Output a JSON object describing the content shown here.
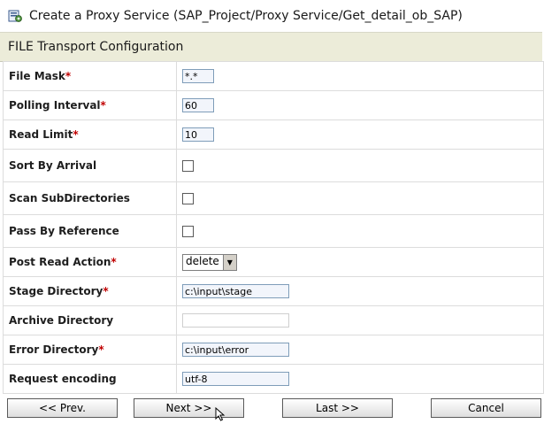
{
  "title": {
    "text": "Create a Proxy Service (SAP_Project/Proxy Service/Get_detail_ob_SAP)",
    "icon": "proxy-service-icon"
  },
  "section": {
    "title": "FILE Transport Configuration"
  },
  "form": {
    "file_mask": {
      "label": "File Mask",
      "required": "*",
      "value": "*.*"
    },
    "polling_interval": {
      "label": "Polling Interval",
      "required": "*",
      "value": "60"
    },
    "read_limit": {
      "label": "Read Limit",
      "required": "*",
      "value": "10"
    },
    "sort_by_arrival": {
      "label": "Sort By Arrival",
      "checked": false
    },
    "scan_subdirectories": {
      "label": "Scan SubDirectories",
      "checked": false
    },
    "pass_by_reference": {
      "label": "Pass By Reference",
      "checked": false
    },
    "post_read_action": {
      "label": "Post Read Action",
      "required": "*",
      "value": "delete"
    },
    "stage_directory": {
      "label": "Stage Directory",
      "required": "*",
      "value": "c:\\input\\stage"
    },
    "archive_directory": {
      "label": "Archive Directory",
      "value": ""
    },
    "error_directory": {
      "label": "Error Directory",
      "required": "*",
      "value": "c:\\input\\error"
    },
    "request_encoding": {
      "label": "Request encoding",
      "value": "utf-8"
    }
  },
  "buttons": {
    "prev": "<< Prev.",
    "next": "Next >>",
    "last": "Last >>",
    "cancel": "Cancel"
  },
  "colors": {
    "required": "#c00000",
    "header_bg": "#ececd9",
    "input_bg": "#f2f5fb",
    "input_border": "#7f9db9"
  }
}
